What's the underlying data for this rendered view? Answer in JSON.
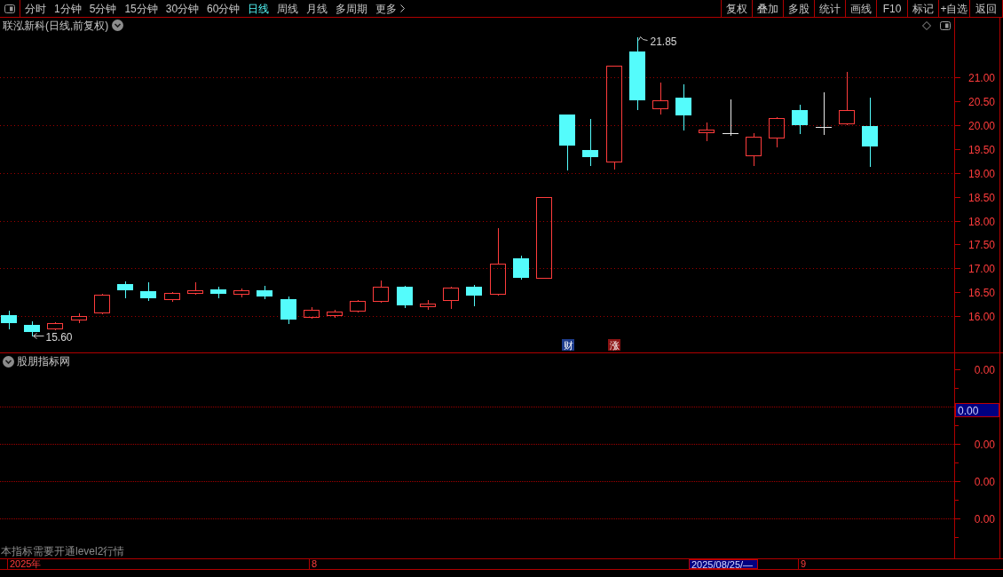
{
  "toolbar": {
    "periods": [
      {
        "label": "分时",
        "kind": "period",
        "selected": false
      },
      {
        "label": "1分钟",
        "kind": "period",
        "selected": false
      },
      {
        "label": "5分钟",
        "kind": "period",
        "selected": false
      },
      {
        "label": "15分钟",
        "kind": "period",
        "selected": false
      },
      {
        "label": "30分钟",
        "kind": "period",
        "selected": false
      },
      {
        "label": "60分钟",
        "kind": "period",
        "selected": false
      },
      {
        "label": "日线",
        "kind": "period",
        "selected": true
      },
      {
        "label": "周线",
        "kind": "period",
        "selected": false
      },
      {
        "label": "月线",
        "kind": "period",
        "selected": false
      },
      {
        "label": "多周期",
        "kind": "period",
        "selected": false
      },
      {
        "label": "更多",
        "kind": "menu",
        "selected": false
      }
    ],
    "buttons": [
      "复权",
      "叠加",
      "多股",
      "统计",
      "画线",
      "F10",
      "标记",
      "+自选",
      "返回"
    ]
  },
  "main_chart": {
    "title": "联泓新科(日线,前复权)",
    "price_axis": [
      "21.00",
      "20.50",
      "20.00",
      "19.50",
      "19.00",
      "18.50",
      "18.00",
      "17.50",
      "17.00",
      "16.50",
      "16.00"
    ],
    "high_label": "21.85",
    "low_label": "15.60",
    "event_markers": [
      {
        "text": "财",
        "color": "#1e3c8c"
      },
      {
        "text": "涨",
        "color": "#8c1414"
      }
    ]
  },
  "indicator": {
    "title": "股朋指标网",
    "axis": [
      {
        "kind": "tick",
        "label": "0.00"
      },
      {
        "kind": "cursor",
        "label": "0.00"
      },
      {
        "kind": "tick",
        "label": "0.00"
      },
      {
        "kind": "tick",
        "label": "0.00"
      },
      {
        "kind": "tick",
        "label": "0.00"
      }
    ],
    "note": "本指标需要开通level2行情"
  },
  "time_axis": {
    "labels": [
      "2025年",
      "8",
      "9"
    ],
    "cursor_date": "2025/08/25/—"
  }
}
